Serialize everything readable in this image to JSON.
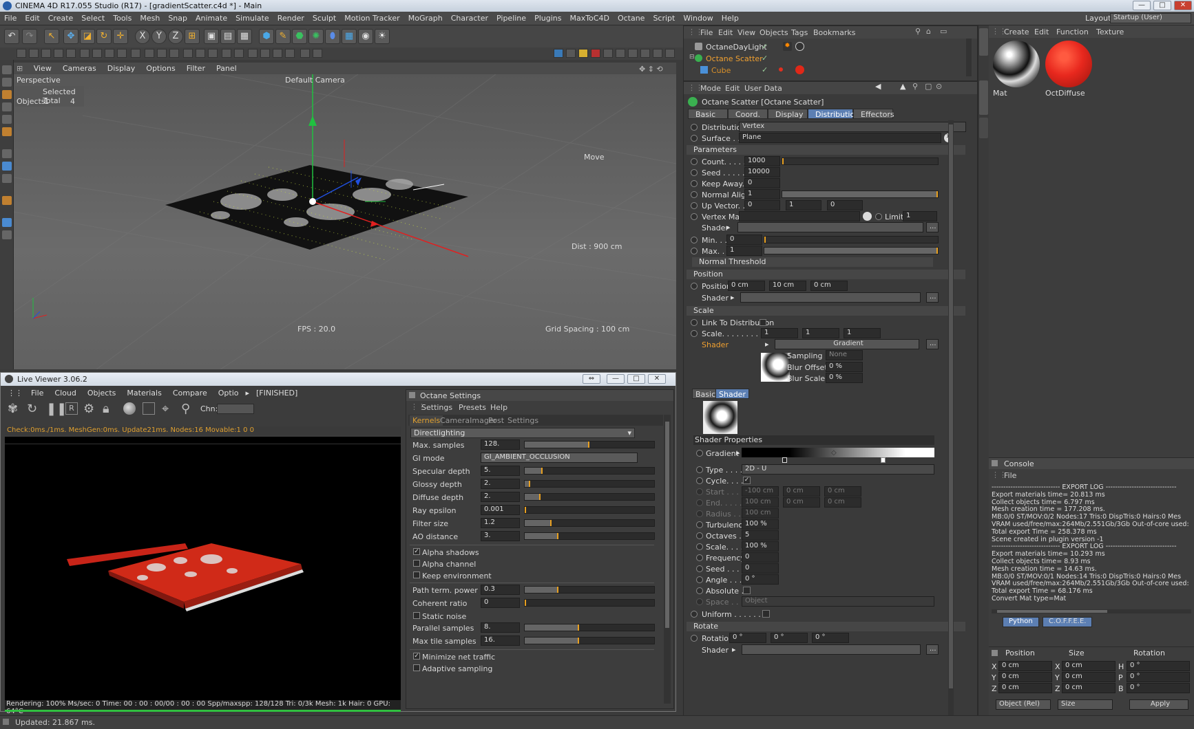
{
  "window": {
    "title": "CINEMA 4D R17.055 Studio (R17) - [gradientScatter.c4d *] - Main",
    "layout_label": "Layout:",
    "layout_value": "Startup (User)"
  },
  "menu": [
    "File",
    "Edit",
    "Create",
    "Select",
    "Tools",
    "Mesh",
    "Snap",
    "Animate",
    "Simulate",
    "Render",
    "Sculpt",
    "Motion Tracker",
    "MoGraph",
    "Character",
    "Pipeline",
    "Plugins",
    "MaxToC4D",
    "Octane",
    "Script",
    "Window",
    "Help"
  ],
  "viewport": {
    "menu": [
      "View",
      "Cameras",
      "Display",
      "Options",
      "Filter",
      "Panel"
    ],
    "name": "Perspective",
    "camera": "Default Camera",
    "stats_header": "Selected Total",
    "stats_label": "Objects",
    "stats_selected": "1",
    "stats_total": "4",
    "move": "Move",
    "dist": "Dist : 900 cm",
    "fps": "FPS : 20.0",
    "grid": "Grid Spacing : 100 cm"
  },
  "live_viewer": {
    "title": "Live Viewer 3.06.2",
    "menu": [
      "File",
      "Cloud",
      "Objects",
      "Materials",
      "Compare",
      "Optio"
    ],
    "status_tag": "[FINISHED]",
    "chn_label": "Chn:",
    "stats": "Check:0ms./1ms. MeshGen:0ms. Update21ms. Nodes:16 Movable:1  0 0",
    "render_status": "Rendering: 100%  Ms/sec: 0    Time: 00 : 00 : 00/00 : 00 : 00   Spp/maxspp: 128/128    Tri: 0/3k  Mesh: 1k    Hair: 0     GPU:         64°C"
  },
  "octane_settings": {
    "title": "Octane Settings",
    "menu": [
      "Settings",
      "Presets",
      "Help"
    ],
    "tabs": [
      "Kernels",
      "CameraImager",
      "Post",
      "Settings"
    ],
    "kernel": "Directlighting",
    "rows": [
      {
        "label": "Max. samples",
        "value": "128.",
        "fill": 0.5
      },
      {
        "label": "GI mode",
        "value": "GI_AMBIENT_OCCLUSION"
      },
      {
        "label": "Specular depth",
        "value": "5.",
        "fill": 0.14
      },
      {
        "label": "Glossy depth",
        "value": "2.",
        "fill": 0.04
      },
      {
        "label": "Diffuse depth",
        "value": "2.",
        "fill": 0.12
      },
      {
        "label": "Ray epsilon",
        "value": "0.001",
        "fill": 0.0
      },
      {
        "label": "Filter size",
        "value": "1.2",
        "fill": 0.21
      },
      {
        "label": "AO distance",
        "value": "3.",
        "fill": 0.26
      }
    ],
    "checks1": [
      {
        "label": "Alpha shadows",
        "checked": "✓"
      },
      {
        "label": "Alpha channel",
        "checked": ""
      },
      {
        "label": "Keep environment",
        "checked": ""
      }
    ],
    "rows2": [
      {
        "label": "Path term. power",
        "value": "0.3",
        "fill": 0.26
      },
      {
        "label": "Coherent ratio",
        "value": "0",
        "fill": 0.0
      }
    ],
    "check_static": {
      "label": "Static noise",
      "checked": ""
    },
    "rows3": [
      {
        "label": "Parallel samples",
        "value": "8.",
        "fill": 0.42
      },
      {
        "label": "Max tile samples",
        "value": "16.",
        "fill": 0.42
      }
    ],
    "checks2": [
      {
        "label": "Minimize net traffic",
        "checked": "✓"
      },
      {
        "label": "Adaptive sampling",
        "checked": ""
      }
    ]
  },
  "objects": {
    "menu": [
      "File",
      "Edit",
      "View",
      "Objects",
      "Tags",
      "Bookmarks"
    ],
    "items": [
      "OctaneDayLight",
      "Octane Scatter",
      "Cube"
    ]
  },
  "attributes": {
    "menu": [
      "Mode",
      "Edit",
      "User Data"
    ],
    "title": "Octane Scatter [Octane Scatter]",
    "tabs": [
      "Basic",
      "Coord.",
      "Display",
      "Distribution",
      "Effectors"
    ],
    "distribution_label": "Distribution",
    "distribution_value": "Vertex",
    "surface_label": "Surface . .",
    "surface_value": "Plane",
    "parameters": "Parameters",
    "count_label": "Count. . . . . .",
    "count": "1000",
    "seed_label": "Seed . . . . . .",
    "seed": "10000",
    "keepaway_label": "Keep Away. .",
    "keepaway": "0",
    "normalalign_label": "Normal Align",
    "normalalign": "1",
    "upvector_label": "Up Vector. . .",
    "upvector": [
      "0",
      "1",
      "0"
    ],
    "vertexmap_label": "Vertex Map",
    "limit_label": "Limit",
    "limit": "1",
    "shader_label": "Shader",
    "min_label": "Min. . .",
    "min": "0",
    "max_label": "Max. . .",
    "max": "1",
    "normal_threshold": "Normal Threshold",
    "position": "Position",
    "position_label": "Position",
    "position_values": [
      "0 cm",
      "10 cm",
      "0 cm"
    ],
    "scale": "Scale",
    "link_label": "Link To Distribution",
    "scale_label": "Scale. . . . . . . .",
    "scale_values": [
      "1",
      "1",
      "1"
    ],
    "gradient_btn": "Gradient",
    "sampling_label": "Sampling",
    "sampling": "None",
    "bluroffset_label": "Blur Offset",
    "bluroffset": "0 %",
    "blurscale_label": "Blur Scale",
    "blurscale": "0 %",
    "subtabs": [
      "Basic",
      "Shader"
    ],
    "shader_properties": "Shader Properties",
    "gradient_label": "Gradient",
    "type_label": "Type . . . . .",
    "type": "2D - U",
    "cycle_label": "Cycle. . . . .",
    "cycle": "✓",
    "start_label": "Start . . . . .",
    "start": [
      "-100 cm",
      "0 cm",
      "0 cm"
    ],
    "end_label": "End. . . . . .",
    "end": [
      "100 cm",
      "0 cm",
      "0 cm"
    ],
    "radius_label": "Radius . . . .",
    "radius": "100 cm",
    "turbulence_label": "Turbulence",
    "turbulence": "100 %",
    "octaves_label": "Octaves . . .",
    "octaves": "5",
    "scale2_label": "Scale. . . . .",
    "scale2": "100 %",
    "frequency_label": "Frequency",
    "frequency": "0",
    "seed2_label": "Seed . . . . .",
    "seed2": "0",
    "angle_label": "Angle . . . .",
    "angle": "0 °",
    "absolute_label": "Absolute . .",
    "space_label": "Space . . . .",
    "space": "Object",
    "uniform_label": "Uniform . . . . . . . .",
    "rotate": "Rotate",
    "rotation_label": "Rotation",
    "rotation": [
      "0 °",
      "0 °",
      "0 °"
    ]
  },
  "materials": {
    "menu": [
      "Create",
      "Edit",
      "Function",
      "Texture"
    ],
    "items": [
      {
        "name": "Mat"
      },
      {
        "name": "OctDiffuse"
      }
    ]
  },
  "console": {
    "title": "Console",
    "menu": "File",
    "lines": [
      "----------------------------- EXPORT LOG ------------------------------",
      "Export materials time= 20.813 ms",
      "Collect objects time= 6.797 ms",
      "Mesh creation time = 177.208 ms.",
      "MB:0/0  ST/MOV:0/2  Nodes:17  Tris:0  DispTris:0  Hairs:0  Mes",
      "VRAM used/free/max:264Mb/2.551Gb/3Gb  Out-of-core used:",
      "Total export Time = 258.378 ms",
      "Scene created in plugin version -1",
      "----------------------------- EXPORT LOG ------------------------------",
      "Export materials time= 10.293 ms",
      "Collect objects time= 8.93 ms",
      "Mesh creation time = 14.63 ms.",
      "MB:0/0  ST/MOV:0/1  Nodes:14  Tris:0  DispTris:0  Hairs:0  Mes",
      "VRAM used/free/max:264Mb/2.551Gb/3Gb  Out-of-core used:",
      "Total export Time = 68.176 ms",
      "Convert Mat type=Mat"
    ],
    "tabs": [
      "Python",
      "C.O.F.F.E.E."
    ]
  },
  "coords": {
    "headers": [
      "Position",
      "Size",
      "Rotation"
    ],
    "rows": [
      {
        "axis": "X",
        "pos": "0 cm",
        "saxis": "X",
        "size": "0 cm",
        "raxis": "H",
        "rot": "0 °"
      },
      {
        "axis": "Y",
        "pos": "0 cm",
        "saxis": "Y",
        "size": "0 cm",
        "raxis": "P",
        "rot": "0 °"
      },
      {
        "axis": "Z",
        "pos": "0 cm",
        "saxis": "Z",
        "size": "0 cm",
        "raxis": "B",
        "rot": "0 °"
      }
    ],
    "mode1": "Object (Rel)",
    "mode2": "Size",
    "apply": "Apply"
  },
  "statusbar": {
    "text": "Updated: 21.867 ms."
  },
  "colors": {
    "accent": "#5c7fb3",
    "highlight": "#e8a020",
    "red": "#e8281e"
  }
}
